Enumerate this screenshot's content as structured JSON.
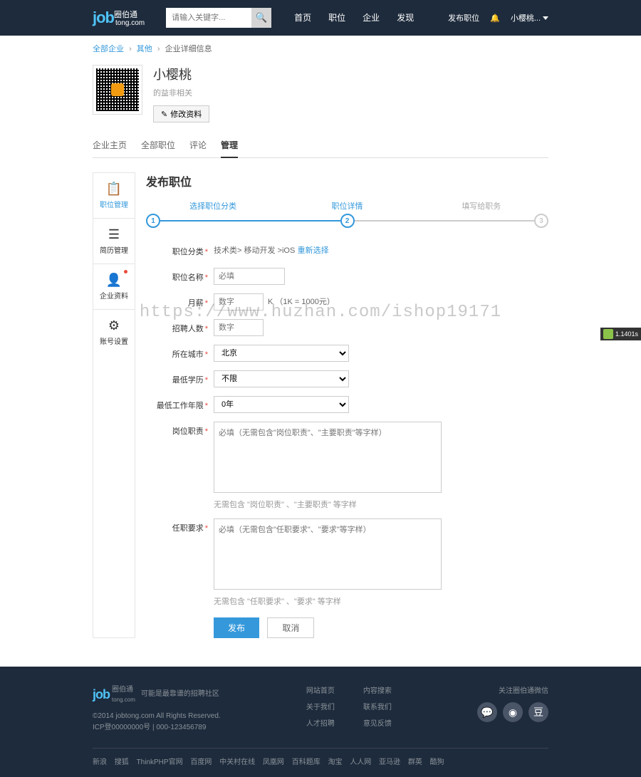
{
  "header": {
    "logo_main": "job",
    "logo_cn": "圈伯通",
    "logo_sub": "tong.com",
    "search_placeholder": "请输入关键字...",
    "nav": [
      "首页",
      "职位",
      "企业",
      "发现"
    ],
    "publish": "发布职位",
    "username": "小樱桃..."
  },
  "breadcrumb": {
    "all_companies": "全部企业",
    "other": "其他",
    "current": "企业详细信息"
  },
  "profile": {
    "name": "小樱桃",
    "meta": "的益非相关",
    "edit_btn": "修改资料"
  },
  "tabs": [
    "企业主页",
    "全部职位",
    "评论",
    "管理"
  ],
  "sidebar": [
    {
      "label": "职位管理",
      "icon": "📋"
    },
    {
      "label": "简历管理",
      "icon": "☰"
    },
    {
      "label": "企业资料",
      "icon": "👤",
      "dot": true
    },
    {
      "label": "账号设置",
      "icon": "⚙"
    }
  ],
  "page_title": "发布职位",
  "steps": [
    "选择职位分类",
    "职位详情",
    "填写给职务"
  ],
  "form": {
    "category": {
      "label": "职位分类",
      "value": "技术类> 移动开发 >iOS",
      "reselect": "重新选择"
    },
    "name": {
      "label": "职位名称",
      "placeholder": "必填"
    },
    "salary": {
      "label": "月薪",
      "placeholder": "数字",
      "suffix": "K （1K = 1000元）"
    },
    "headcount": {
      "label": "招聘人数",
      "placeholder": "数字"
    },
    "city": {
      "label": "所在城市",
      "value": "北京"
    },
    "education": {
      "label": "最低学历",
      "value": "不限"
    },
    "experience": {
      "label": "最低工作年限",
      "value": "0年"
    },
    "responsibility": {
      "label": "岗位职责",
      "placeholder": "必填（无需包含\"岗位职责\"、\"主要职责\"等字样）",
      "hint": "无需包含 \"岗位职责\" 、\"主要职责\" 等字样"
    },
    "requirement": {
      "label": "任职要求",
      "placeholder": "必填（无需包含\"任职要求\"、\"要求\"等字样）",
      "hint": "无需包含 \"任职要求\" 、\"要求\" 等字样"
    },
    "submit": "发布",
    "cancel": "取消"
  },
  "footer": {
    "slogan": "可能是最靠谱的招聘社区",
    "copyright": "©2014 jobtong.com All Rights Reserved.",
    "icp": "ICP登00000000号 | 000-123456789",
    "col1": [
      "网站首页",
      "关于我们",
      "人才招聘"
    ],
    "col2": [
      "内容搜索",
      "联系我们",
      "意见反馈"
    ],
    "social_title": "关注圈伯通微信",
    "bottom_links": [
      "新浪",
      "搜狐",
      "ThinkPHP官网",
      "百度网",
      "中关村在线",
      "凤凰网",
      "百科题库",
      "淘宝",
      "人人网",
      "亚马逊",
      "群英",
      "酷狗"
    ]
  },
  "watermark": "https://www.huzhan.com/ishop19171",
  "perf": "1.1401s"
}
